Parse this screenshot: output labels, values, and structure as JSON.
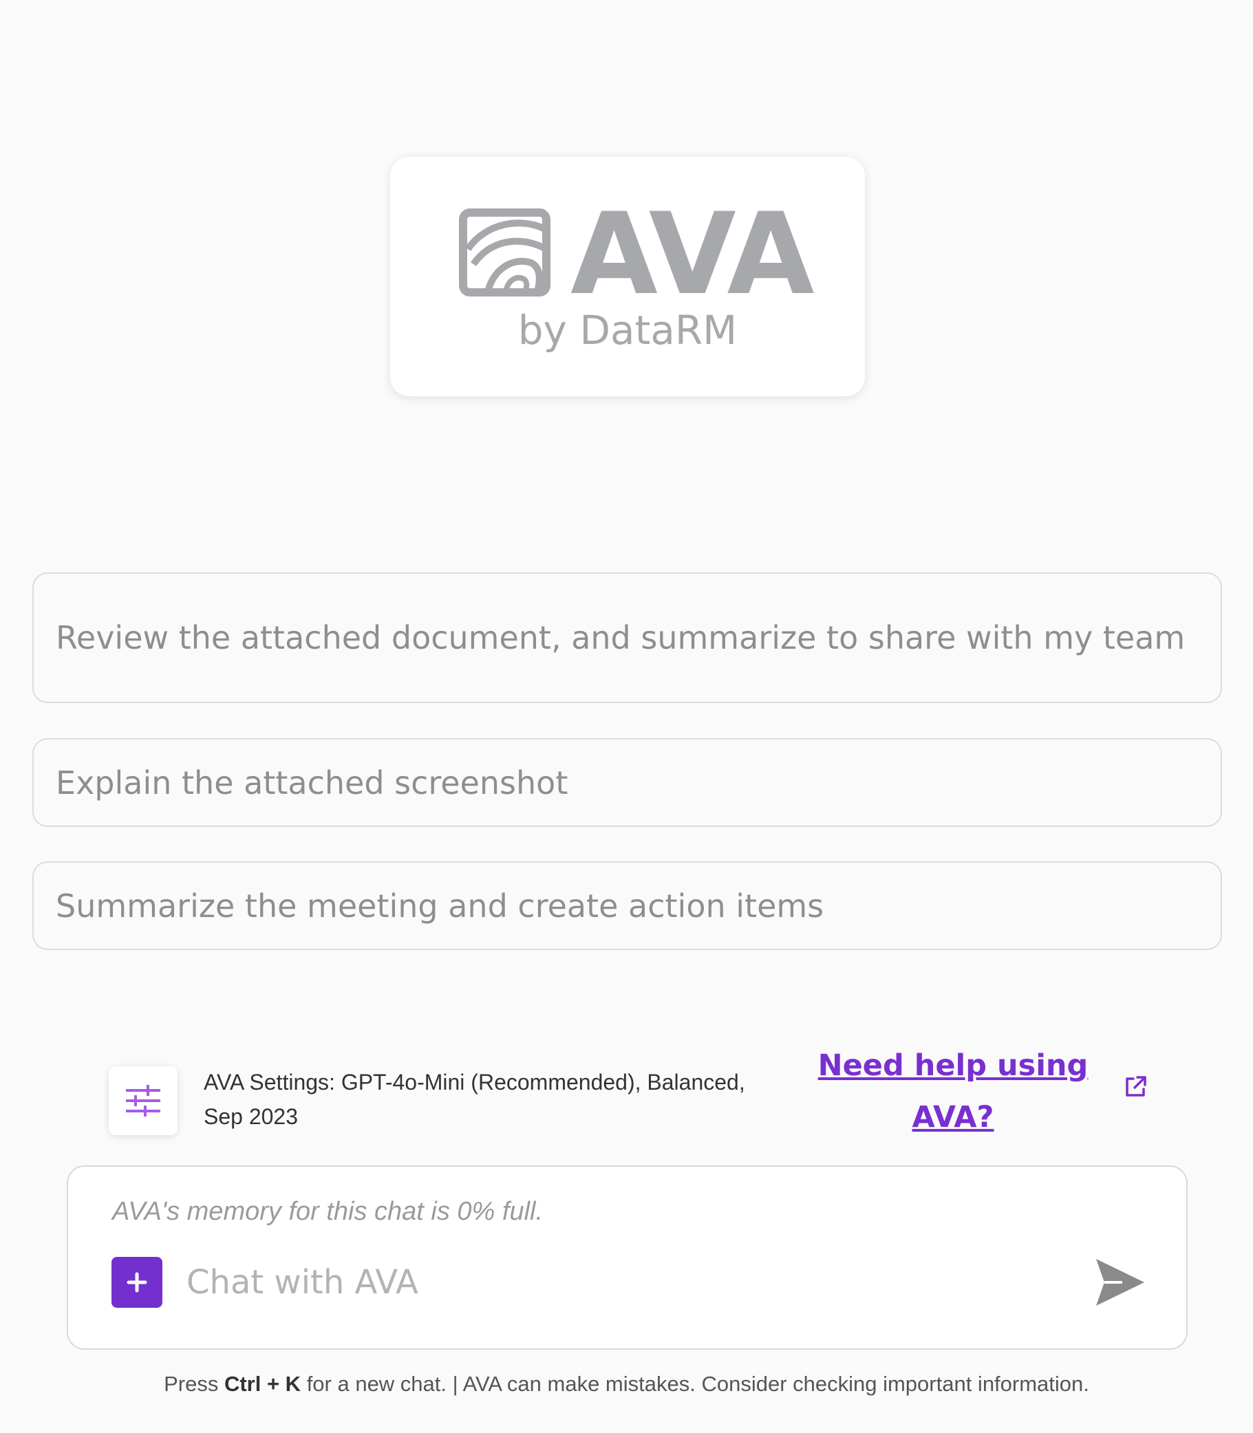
{
  "logo": {
    "wordmark": "AVA",
    "subtitle": "by DataRM",
    "icon": "ava-swirl-logo-icon"
  },
  "prompts": [
    "Review the attached document, and summarize to share with my team",
    "Explain the attached screenshot",
    "Summarize the meeting and create action items"
  ],
  "settings": {
    "icon": "sliders-icon",
    "summary": "AVA Settings: GPT-4o-Mini (Recommended), Balanced, Sep 2023"
  },
  "help": {
    "link_text": "Need help using AVA?",
    "icon": "external-link-icon"
  },
  "chat": {
    "memory_note": "AVA's memory for this chat is 0% full.",
    "placeholder": "Chat with AVA",
    "add_icon": "plus-icon",
    "send_icon": "send-icon"
  },
  "footer": {
    "press": "Press",
    "shortcut": "Ctrl + K",
    "rest": "for a new chat. | AVA can make mistakes. Consider checking important information."
  },
  "colors": {
    "accent": "#7330cf",
    "link": "#7a2fd0",
    "logo_gray": "#a7a8ab",
    "settings_icon": "#a55ce6",
    "send_icon": "#8a8a8a"
  }
}
